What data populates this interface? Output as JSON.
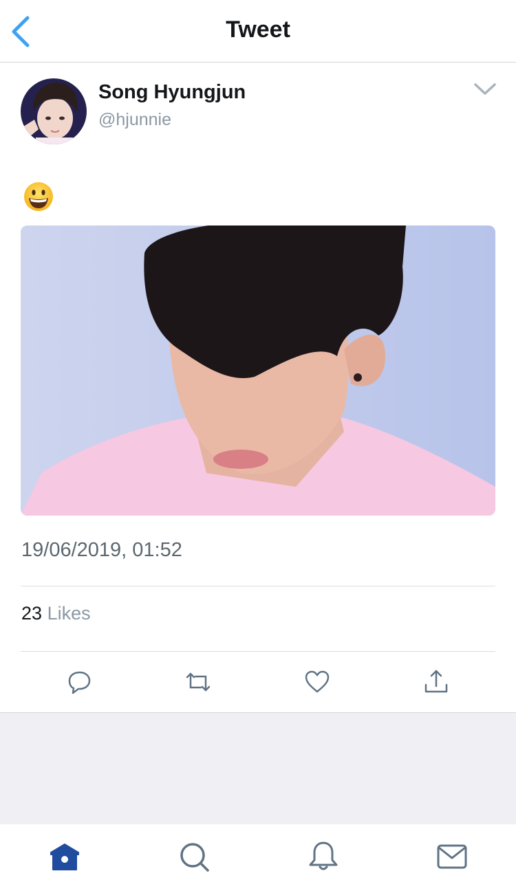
{
  "header": {
    "title": "Tweet",
    "back_icon": "chevron-left-icon"
  },
  "tweet": {
    "author_name": "Song Hyungjun",
    "author_handle": "@hjunnie",
    "emoji_icon": "grinning-face-emoji",
    "media_description_icon": "photo",
    "timestamp": "19/06/2019, 01:52",
    "likes_count": "23",
    "likes_label": "Likes"
  },
  "actions": [
    "reply-icon",
    "retweet-icon",
    "like-icon",
    "share-icon"
  ],
  "tabbar": [
    "home-icon",
    "search-icon",
    "notifications-icon",
    "messages-icon"
  ],
  "colors": {
    "accent": "#1da1f2",
    "home_active": "#1f4c9e",
    "icon_gray": "#657786",
    "divider": "#d8dce0",
    "background_gray": "#efeff4"
  }
}
